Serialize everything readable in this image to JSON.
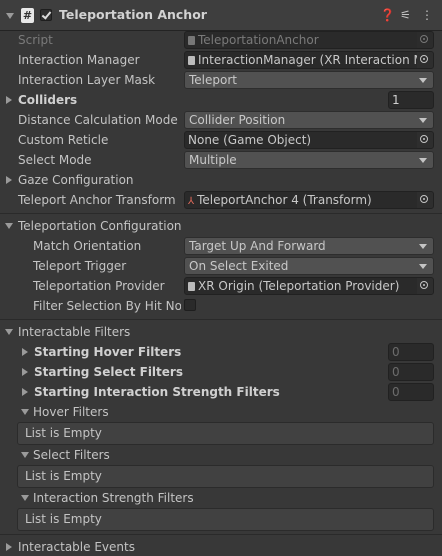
{
  "component": {
    "title": "Teleportation Anchor",
    "enabled": true
  },
  "fields": {
    "script_label": "Script",
    "script_value": "TeleportationAnchor",
    "interaction_manager_label": "Interaction Manager",
    "interaction_manager_value": "InteractionManager (XR Interaction Ma",
    "interaction_layer_mask_label": "Interaction Layer Mask",
    "interaction_layer_mask_value": "Teleport",
    "colliders_label": "Colliders",
    "colliders_count": "1",
    "distance_calc_label": "Distance Calculation Mode",
    "distance_calc_value": "Collider Position",
    "custom_reticle_label": "Custom Reticle",
    "custom_reticle_value": "None (Game Object)",
    "select_mode_label": "Select Mode",
    "select_mode_value": "Multiple",
    "gaze_config_label": "Gaze Configuration",
    "teleport_anchor_transform_label": "Teleport Anchor Transform",
    "teleport_anchor_transform_value": "TeleportAnchor 4 (Transform)"
  },
  "teleportation_configuration": {
    "label": "Teleportation Configuration",
    "match_orientation_label": "Match Orientation",
    "match_orientation_value": "Target Up And Forward",
    "teleport_trigger_label": "Teleport Trigger",
    "teleport_trigger_value": "On Select Exited",
    "teleportation_provider_label": "Teleportation Provider",
    "teleportation_provider_value": "XR Origin (Teleportation Provider)",
    "filter_selection_label": "Filter Selection By Hit Norm",
    "filter_selection_checked": false
  },
  "interactable_filters": {
    "label": "Interactable Filters",
    "starting_hover_label": "Starting Hover Filters",
    "starting_hover_count": "0",
    "starting_select_label": "Starting Select Filters",
    "starting_select_count": "0",
    "starting_strength_label": "Starting Interaction Strength Filters",
    "starting_strength_count": "0",
    "hover_filters_label": "Hover Filters",
    "hover_filters_empty": "List is Empty",
    "select_filters_label": "Select Filters",
    "select_filters_empty": "List is Empty",
    "strength_filters_label": "Interaction Strength Filters",
    "strength_filters_empty": "List is Empty"
  },
  "interactable_events_label": "Interactable Events",
  "colors": {
    "background": "#383838",
    "header": "#3e3e3e",
    "field": "#2a2a2a",
    "popup": "#515151",
    "text": "#c4c4c4"
  },
  "icons": [
    "collapse-arrow-icon",
    "script-icon",
    "checkbox-icon",
    "help-icon",
    "presets-icon",
    "more-options-icon",
    "object-picker-icon",
    "transform-icon",
    "file-icon"
  ]
}
